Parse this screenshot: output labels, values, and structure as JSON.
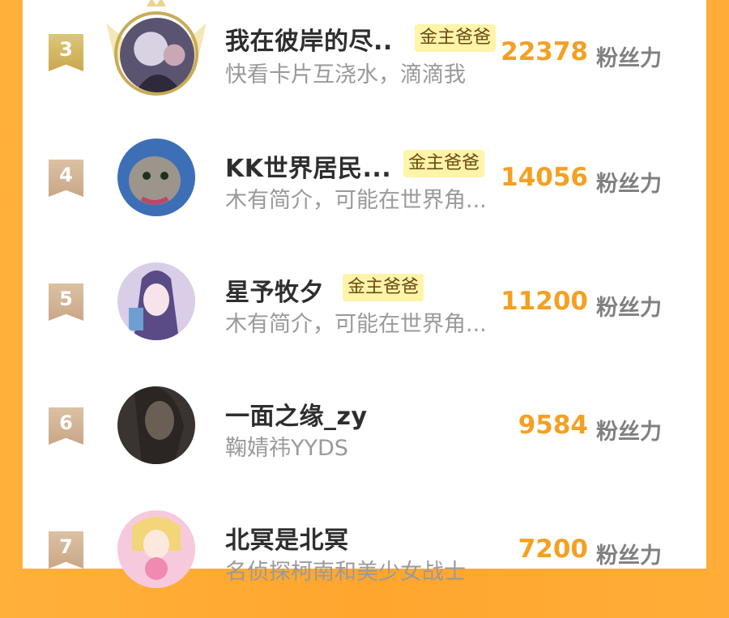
{
  "colors": {
    "accent": "#f4a022",
    "badge_bg": "#fff4a8",
    "page_bg": "#ffa62e"
  },
  "rows": [
    {
      "rank": "3",
      "name": "我在彼岸的尽..",
      "badge": "金主爸爸",
      "desc": "快看卡片互浇水，滴滴我",
      "score": "22378",
      "unit": "粉丝力"
    },
    {
      "rank": "4",
      "name": "KK世界居民...",
      "badge": "金主爸爸",
      "desc": "木有简介，可能在世界角...",
      "score": "14056",
      "unit": "粉丝力"
    },
    {
      "rank": "5",
      "name": "星予牧夕",
      "badge": "金主爸爸",
      "desc": "木有简介，可能在世界角...",
      "score": "11200",
      "unit": "粉丝力"
    },
    {
      "rank": "6",
      "name": "一面之缘_zy",
      "badge": "",
      "desc": "鞠婧祎YYDS",
      "score": "9584",
      "unit": "粉丝力"
    },
    {
      "rank": "7",
      "name": "北冥是北冥",
      "badge": "",
      "desc": "名侦探柯南和美少女战士",
      "score": "7200",
      "unit": "粉丝力"
    }
  ]
}
